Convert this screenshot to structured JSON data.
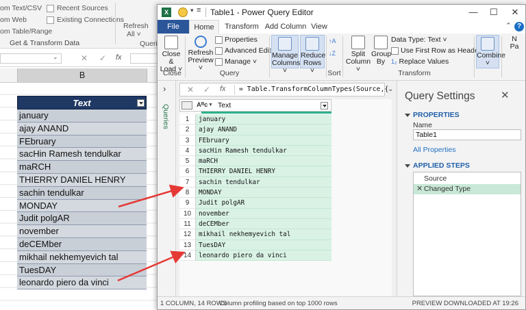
{
  "excel": {
    "ribbon": {
      "items": [
        "om Text/CSV",
        "om Web",
        "om Table/Range",
        "Recent Sources",
        "Existing Connections",
        "Refresh",
        "All ˅",
        "Queri"
      ],
      "group_label": "Get & Transform Data"
    },
    "formula_bar": {
      "cancel": "✕",
      "enter": "✓",
      "fx": "fx"
    },
    "column_header": "B",
    "table": {
      "header": "Text",
      "rows": [
        "january",
        "ajay ANAND",
        "FEbruary",
        "sacHin Ramesh tendulkar",
        "maRCH",
        "THIERRY DANIEL HENRY",
        "sachin tendulkar",
        "MONDAY",
        "Judit polgAR",
        "november",
        "deCEMber",
        "mikhail nekhemyevich tal",
        "TuesDAY",
        "leonardo piero da vinci"
      ]
    }
  },
  "pq": {
    "title": "Table1 - Power Query Editor",
    "window_buttons": {
      "minimize": "—",
      "restore": "☐",
      "close": "✕"
    },
    "tabs": [
      "File",
      "Home",
      "Transform",
      "Add Column",
      "View"
    ],
    "help": "?",
    "ribbon": {
      "close_load": "Close &\nLoad ˅",
      "refresh_preview": "Refresh\nPreview ˅",
      "properties": "Properties",
      "advanced_editor": "Advanced Editor",
      "manage": "Manage ˅",
      "manage_columns": "Manage\nColumns ˅",
      "reduce_rows": "Reduce\nRows ˅",
      "split_column": "Split\nColumn ˅",
      "group_by": "Group\nBy",
      "data_type": "Data Type: Text ˅",
      "first_row_headers": "Use First Row as Headers ˅",
      "replace_values": "Replace Values",
      "combine": "Combine\n˅",
      "cut_off": "N\nPa",
      "groups": {
        "close": "Close",
        "query": "Query",
        "sort": "Sort",
        "transform": "Transform",
        "pa": "Pa"
      }
    },
    "queries_label": "Queries",
    "formula": "= Table.TransformColumnTypes(Source,{",
    "grid": {
      "type_icon": "Aᴮc",
      "column": "Text",
      "rows": [
        {
          "n": "1",
          "v": "january"
        },
        {
          "n": "2",
          "v": "ajay ANAND"
        },
        {
          "n": "3",
          "v": "FEbruary"
        },
        {
          "n": "4",
          "v": "sacHin Ramesh tendulkar"
        },
        {
          "n": "5",
          "v": "maRCH"
        },
        {
          "n": "6",
          "v": "THIERRY DANIEL HENRY"
        },
        {
          "n": "7",
          "v": "sachin tendulkar"
        },
        {
          "n": "8",
          "v": "MONDAY"
        },
        {
          "n": "9",
          "v": "Judit polgAR"
        },
        {
          "n": "10",
          "v": "november"
        },
        {
          "n": "11",
          "v": "deCEMber"
        },
        {
          "n": "12",
          "v": "mikhail nekhemyevich tal"
        },
        {
          "n": "13",
          "v": "TuesDAY"
        },
        {
          "n": "14",
          "v": "leonardo piero da vinci"
        }
      ]
    },
    "settings": {
      "title": "Query Settings",
      "properties_header": "PROPERTIES",
      "name_label": "Name",
      "name_value": "Table1",
      "all_properties": "All Properties",
      "steps_header": "APPLIED STEPS",
      "steps": [
        "Source",
        "Changed Type"
      ]
    },
    "status": {
      "left": "1 COLUMN, 14 ROWS",
      "mid": "Column profiling based on top 1000 rows",
      "right": "PREVIEW DOWNLOADED AT 19:26"
    }
  },
  "colors": {
    "accent": "#2b579a",
    "excel_green": "#217346",
    "header_navy": "#1f3864",
    "row_highlight": "#d9f2e5",
    "arrow": "#e53935"
  }
}
